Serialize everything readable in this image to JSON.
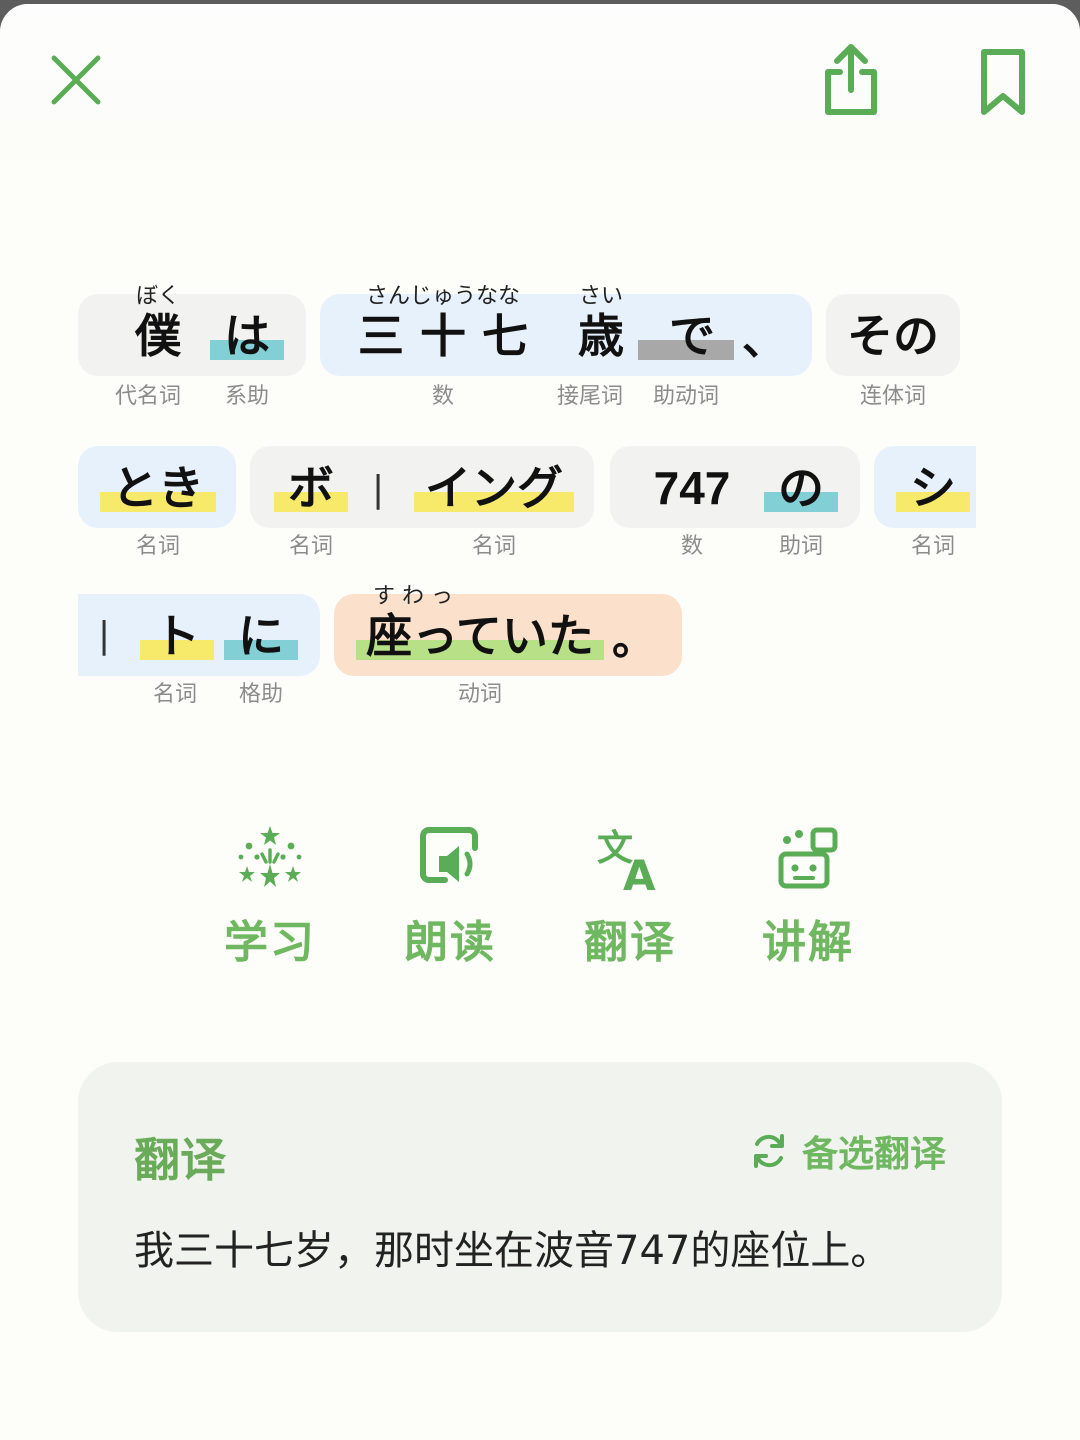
{
  "colors": {
    "accent": "#5aad56",
    "label_green": "#6fb760",
    "underline_noun": "#f7ea6a",
    "underline_particle": "#83cfd6",
    "underline_aux": "#a8a8a8",
    "underline_verb": "#b8e086"
  },
  "toolbar": {
    "close_icon": "close-icon",
    "share_icon": "share-icon",
    "bookmark_icon": "bookmark-icon"
  },
  "sentence": {
    "tokens": {
      "boku": {
        "text": "僕",
        "ruby": "ぼく",
        "pos": "代名词"
      },
      "wa": {
        "text": "は",
        "pos": "系助"
      },
      "num37": {
        "text": "三 十 七",
        "ruby": "さんじゅうなな",
        "pos": "数"
      },
      "sai": {
        "text": "歳",
        "ruby": "さい",
        "pos": "接尾词"
      },
      "de": {
        "text": "で",
        "pos": "助动词"
      },
      "comma": {
        "text": "、"
      },
      "sono": {
        "text": "その",
        "pos": "连体词"
      },
      "toki": {
        "text": "とき",
        "pos": "名词"
      },
      "bo": {
        "text": "ボ",
        "pos": "名词"
      },
      "bar1": {
        "text": "|"
      },
      "ingu": {
        "text": "イング",
        "pos": "名词"
      },
      "n747": {
        "text": "747",
        "pos": "数"
      },
      "no": {
        "text": "の",
        "pos": "助词"
      },
      "shi": {
        "text": "シ",
        "pos": "名词"
      },
      "bar2": {
        "text": "|"
      },
      "to": {
        "text": "ト",
        "pos": "名词"
      },
      "ni": {
        "text": "に",
        "pos": "格助"
      },
      "suwatteita": {
        "text": "座っていた",
        "ruby": "す わ っ",
        "pos": "动词"
      },
      "period": {
        "text": "。"
      }
    }
  },
  "actions": [
    {
      "label": "学习",
      "icon": "sparkle-stars-icon"
    },
    {
      "label": "朗读",
      "icon": "speaker-icon"
    },
    {
      "label": "翻译",
      "icon": "translate-icon"
    },
    {
      "label": "讲解",
      "icon": "explain-icon"
    }
  ],
  "translation": {
    "title": "翻译",
    "alt_label": "备选翻译",
    "alt_icon": "refresh-icon",
    "text": "我三十七岁，那时坐在波音747的座位上。"
  }
}
